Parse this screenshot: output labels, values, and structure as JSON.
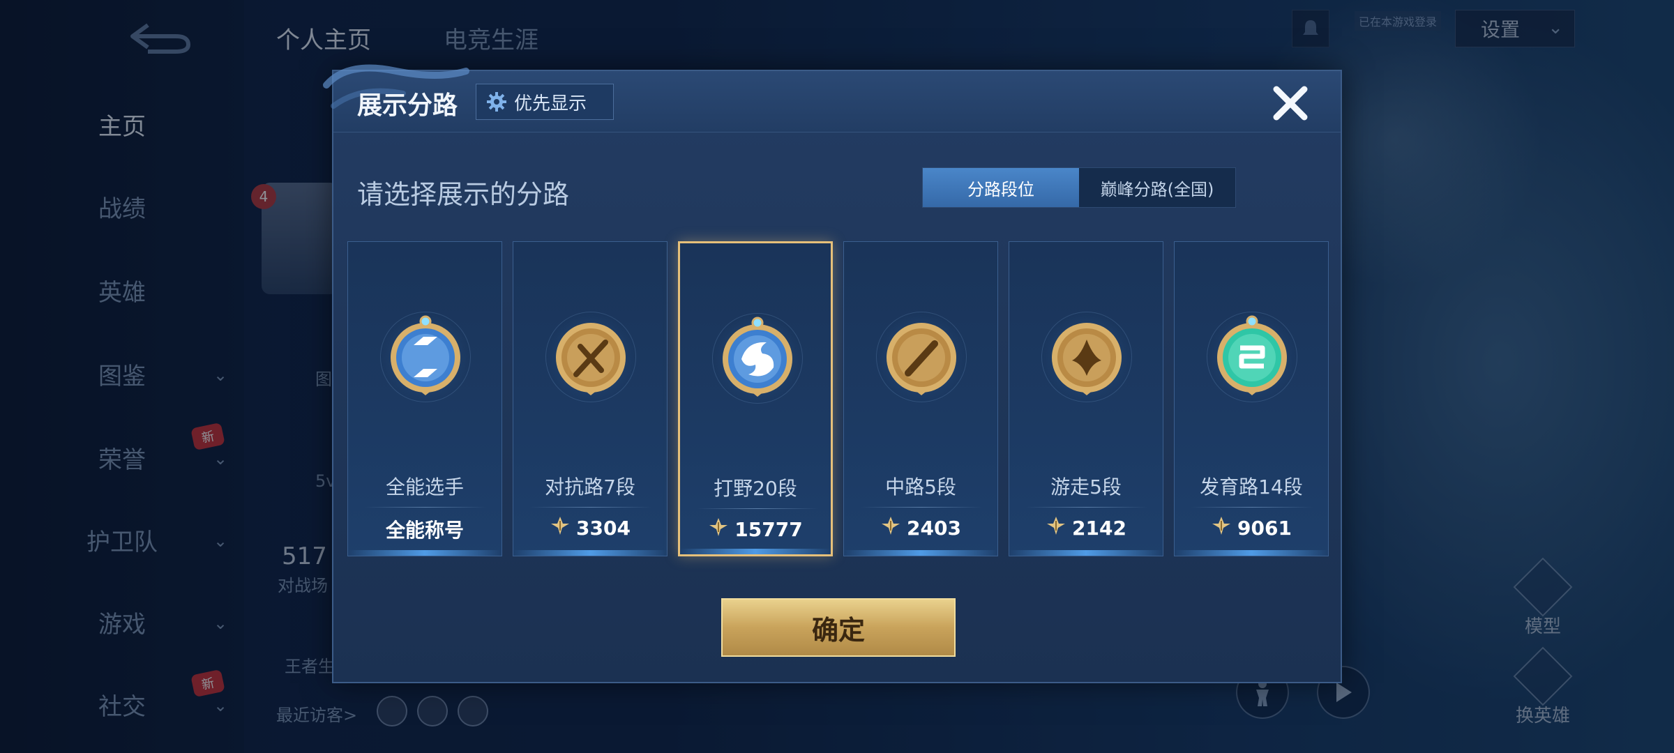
{
  "background": {
    "back_icon": "back-arrow-icon",
    "top_tabs": [
      "个人主页",
      "电竞生涯"
    ],
    "nav_items": [
      {
        "label": "主页",
        "active": true,
        "chevron": false,
        "new": false
      },
      {
        "label": "战绩",
        "active": false,
        "chevron": false,
        "new": false
      },
      {
        "label": "英雄",
        "active": false,
        "chevron": false,
        "new": false
      },
      {
        "label": "图鉴",
        "active": false,
        "chevron": true,
        "new": false
      },
      {
        "label": "荣誉",
        "active": false,
        "chevron": true,
        "new": true
      },
      {
        "label": "护卫队",
        "active": false,
        "chevron": true,
        "new": false
      },
      {
        "label": "游戏",
        "active": false,
        "chevron": true,
        "new": false
      },
      {
        "label": "社交",
        "active": false,
        "chevron": true,
        "new": true
      }
    ],
    "new_badge": "新",
    "badge_count": "4",
    "peek_texts": {
      "tag": "图",
      "level": "5v",
      "score": "517",
      "battle": "对战场",
      "king": "王者生"
    },
    "recent_visitors": "最近访客>",
    "settings_label": "设置",
    "bell_text": "已在本游戏登录",
    "model_label": "模型",
    "swap_hero_label": "换英雄"
  },
  "dialog": {
    "title": "展示分路",
    "priority_label": "优先显示",
    "prompt": "请选择展示的分路",
    "toggle": [
      "分路段位",
      "巅峰分路(全国)"
    ],
    "toggle_active": 0,
    "cards": [
      {
        "label": "全能选手",
        "value": "全能称号",
        "icon": "all-round-emblem-icon",
        "has_point_icon": false,
        "selected": false,
        "theme": "blue"
      },
      {
        "label": "对抗路7段",
        "value": "3304",
        "icon": "clash-lane-emblem-icon",
        "has_point_icon": true,
        "selected": false,
        "theme": "gold"
      },
      {
        "label": "打野20段",
        "value": "15777",
        "icon": "jungle-emblem-icon",
        "has_point_icon": true,
        "selected": true,
        "theme": "blue"
      },
      {
        "label": "中路5段",
        "value": "2403",
        "icon": "mid-lane-emblem-icon",
        "has_point_icon": true,
        "selected": false,
        "theme": "gold"
      },
      {
        "label": "游走5段",
        "value": "2142",
        "icon": "roam-emblem-icon",
        "has_point_icon": true,
        "selected": false,
        "theme": "gold"
      },
      {
        "label": "发育路14段",
        "value": "9061",
        "icon": "farm-lane-emblem-icon",
        "has_point_icon": true,
        "selected": false,
        "theme": "green"
      }
    ],
    "confirm_label": "确定"
  },
  "colors": {
    "accent_gold": "#e6c07a",
    "toggle_active": "#3f7bbf",
    "dialog_bg": "#1f3659"
  }
}
